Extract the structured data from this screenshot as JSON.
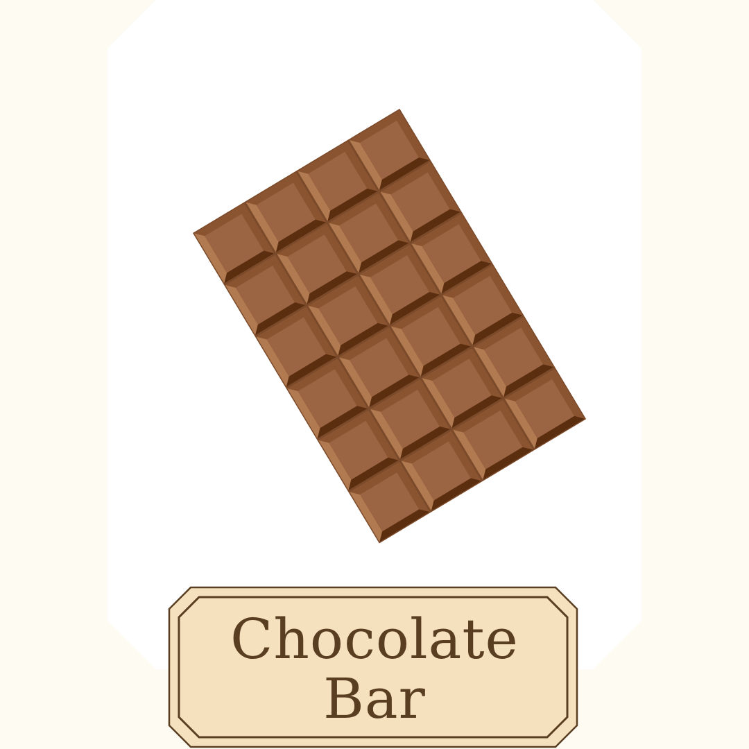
{
  "label": {
    "line1": "Chocolate",
    "line2": "Bar"
  },
  "illustration": {
    "icon": "chocolate-bar-icon",
    "rows": 6,
    "columns": 4,
    "colors": {
      "piece_top": "#9b6442",
      "piece_edge_light": "#b17a50",
      "piece_edge_mid": "#8a5430",
      "piece_edge_dark": "#5c2e10",
      "bar_outline": "#7a4a2a"
    }
  },
  "colors": {
    "background": "#fefbf3",
    "card": "#ffffff",
    "label_fill": "#f5e1bd",
    "label_stroke": "#5a3e22",
    "label_text": "#5a3e22"
  }
}
